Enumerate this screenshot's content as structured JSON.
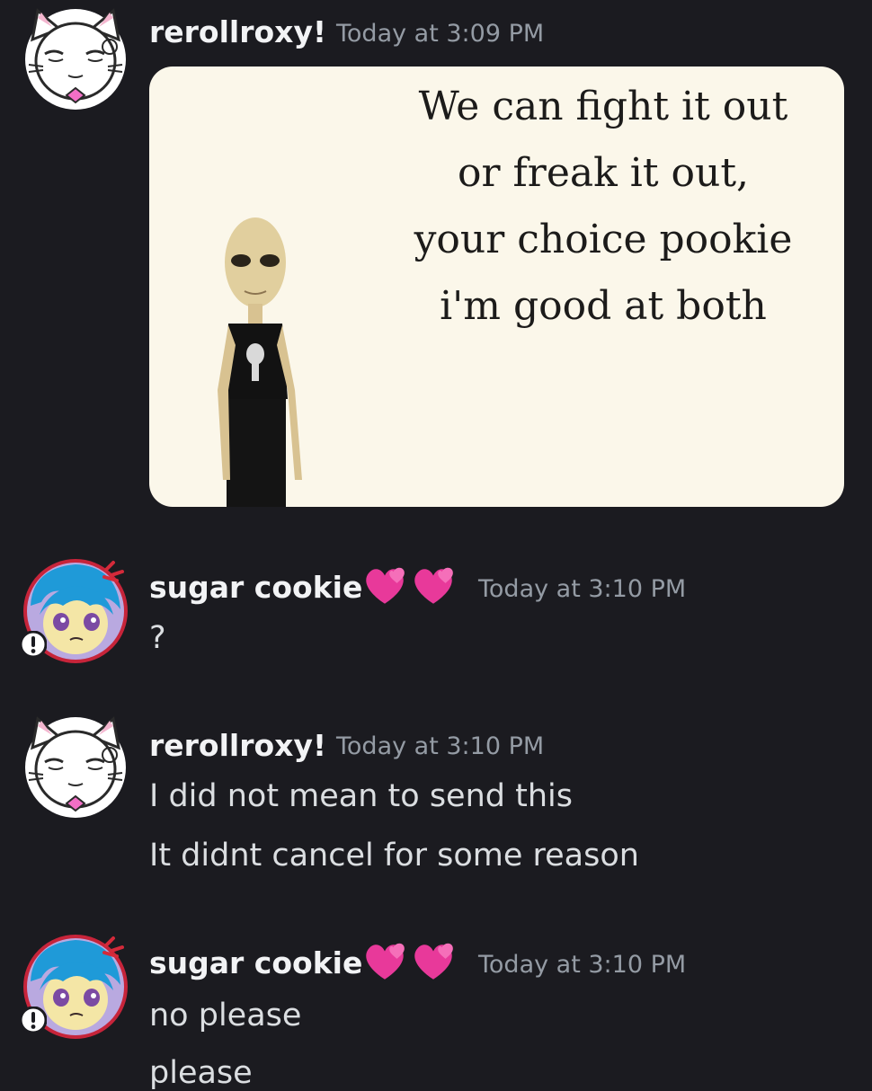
{
  "messages": [
    {
      "username": "rerollroxy!",
      "timestamp": "Today at 3:09 PM",
      "avatar_icon": "cat-eared-character-avatar",
      "attachment": {
        "type": "meme-image",
        "text_lines": [
          "We can fight it out",
          "or freak it out,",
          "your choice pookie",
          "i'm good at both"
        ],
        "image_description_icon": "alien-figure"
      }
    },
    {
      "username": "sugar cookie",
      "badge_emoji": "💕💕",
      "timestamp": "Today at 3:10 PM",
      "avatar_icon": "blue-haired-character-avatar",
      "lines": [
        "?"
      ]
    },
    {
      "username": "rerollroxy!",
      "timestamp": "Today at 3:10 PM",
      "avatar_icon": "cat-eared-character-avatar",
      "lines": [
        "I did not mean to send this",
        "It didnt cancel for some reason"
      ]
    },
    {
      "username": "sugar cookie",
      "badge_emoji": "💕💕",
      "timestamp": "Today at 3:10 PM",
      "avatar_icon": "blue-haired-character-avatar",
      "lines": [
        "no please",
        "please"
      ]
    }
  ],
  "colors": {
    "background": "#1b1b20",
    "username": "#f2f3f5",
    "timestamp": "#949ba4",
    "message_text": "#dbdee1",
    "heart_pink": "#e8399a"
  }
}
